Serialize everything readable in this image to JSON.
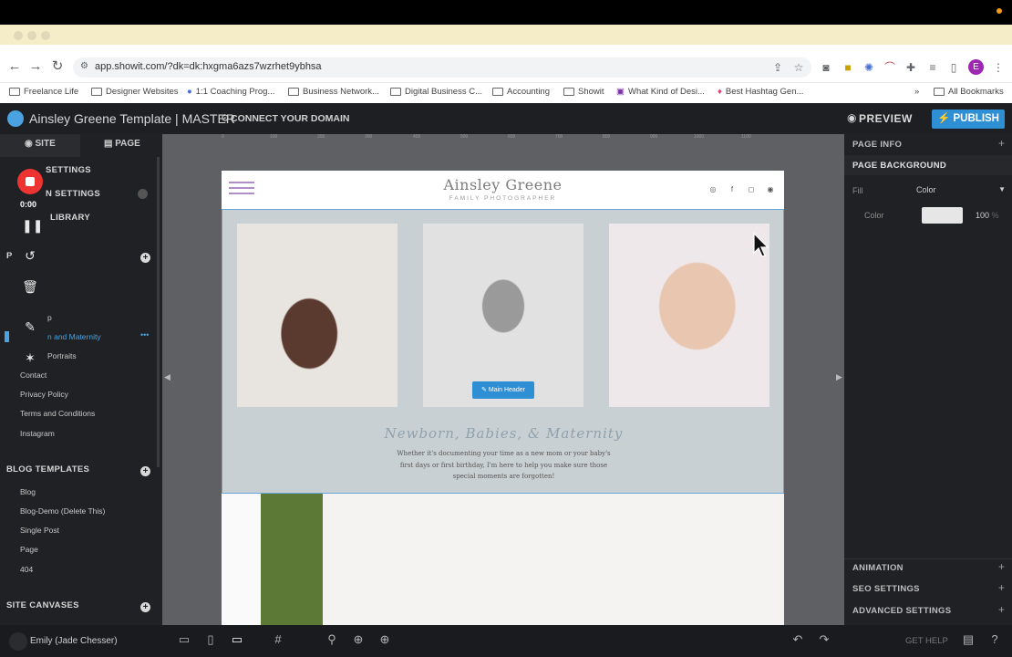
{
  "browser": {
    "url": "app.showit.com/?dk=dk:hxgma6azs7wzrhet9ybhsa",
    "profile_initial": "E",
    "bookmarks": [
      "Freelance Life",
      "Designer Websites",
      "1:1 Coaching Prog...",
      "Business Network...",
      "Digital Business C...",
      "Accounting",
      "Showit",
      "What Kind of Desi...",
      "Best Hashtag Gen..."
    ],
    "all_bookmarks": "All Bookmarks",
    "overflow": "»"
  },
  "app": {
    "title": "Ainsley Greene Template | MASTER",
    "connect_domain": "CONNECT YOUR DOMAIN",
    "preview": "PREVIEW",
    "publish": "PUBLISH"
  },
  "sidebar": {
    "tabs": [
      "SITE",
      "PAGE"
    ],
    "settings": [
      "SETTINGS",
      "N SETTINGS",
      "LIBRARY"
    ],
    "p_label": "P",
    "pages": [
      "p",
      "n and Maternity",
      "Portraits",
      "Contact",
      "Privacy Policy",
      "Terms and Conditions",
      "Instagram"
    ],
    "blog_templates_head": "BLOG TEMPLATES",
    "blog_items": [
      "Blog",
      "Blog-Demo (Delete This)",
      "Single Post",
      "Page",
      "404"
    ],
    "site_canvases_head": "SITE CANVASES",
    "more_dots": "•••"
  },
  "recorder": {
    "time": "0:00"
  },
  "canvas": {
    "ruler_ticks": [
      "0",
      "100",
      "200",
      "300",
      "400",
      "500",
      "600",
      "700",
      "800",
      "900",
      "1000",
      "1100",
      "1200"
    ],
    "brand": "Ainsley Greene",
    "brand_sub": "FAMILY PHOTOGRAPHER",
    "social_icons": [
      "pinterest-icon",
      "facebook-icon",
      "instagram-icon",
      "email-icon"
    ],
    "main_header_tag": "Main Header",
    "section_title": "Newborn, Babies, & Maternity",
    "section_body": "Whether it's documenting your time as a new mom or your baby's first days or first birthday, I'm here to help you make sure those special moments are forgotten!"
  },
  "right_panel": {
    "page_info": "PAGE INFO",
    "page_background": "PAGE BACKGROUND",
    "fill_label": "Fill",
    "fill_value": "Color",
    "color_label": "Color",
    "opacity": "100",
    "opacity_unit": "%",
    "animation": "ANIMATION",
    "seo_settings": "SEO SETTINGS",
    "advanced_settings": "ADVANCED SETTINGS"
  },
  "bottom": {
    "user": "Emily (Jade Chesser)",
    "get_help": "GET HELP"
  },
  "colors": {
    "accent": "#2e8fd4",
    "record": "#ee3333",
    "menu_icon": "#b08fc8"
  }
}
